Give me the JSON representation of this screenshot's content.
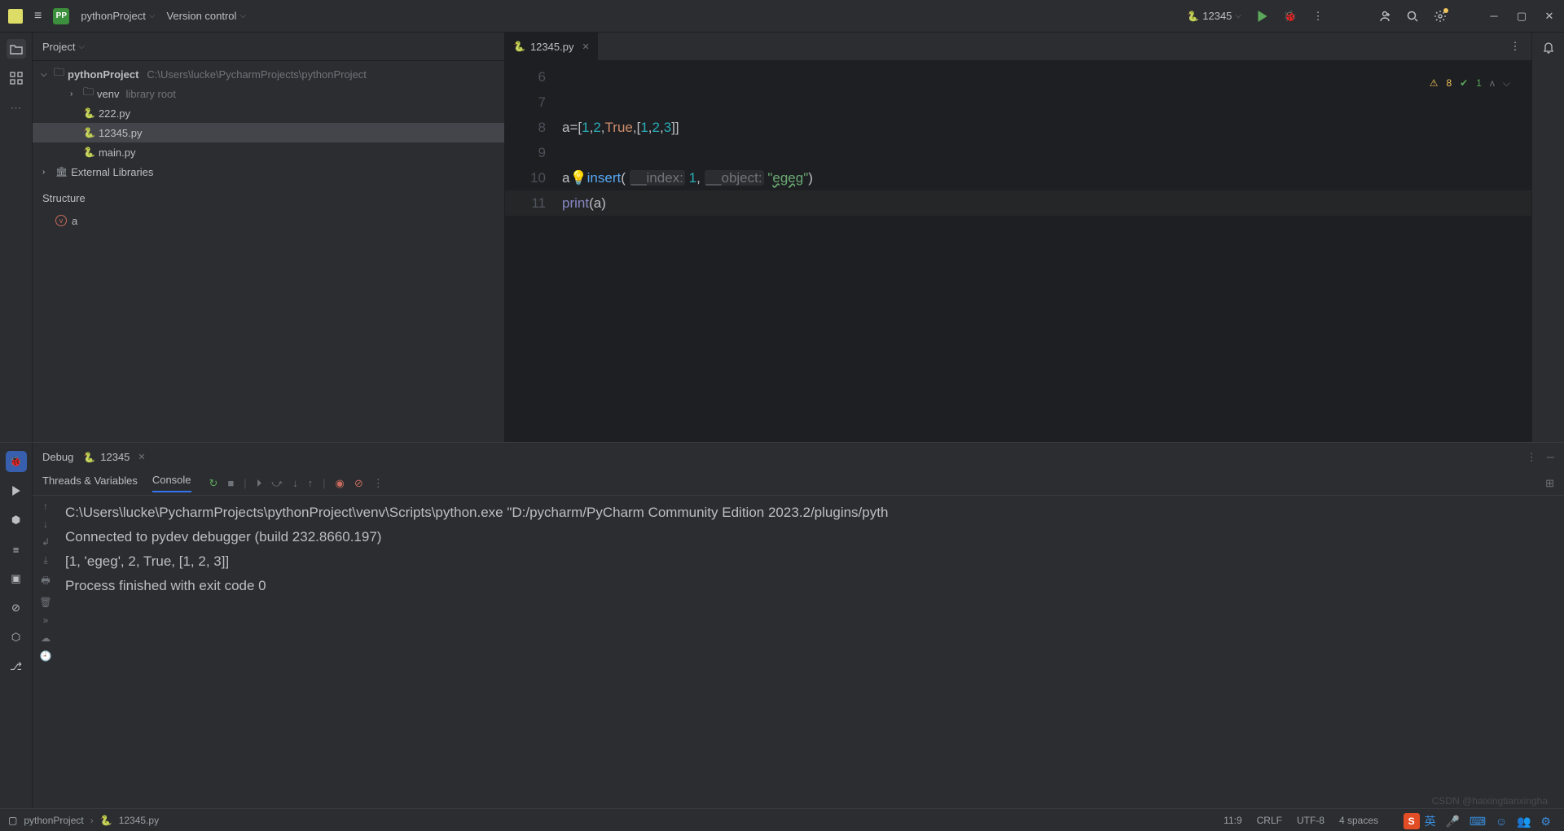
{
  "titlebar": {
    "project_label": "pythonProject",
    "version_control": "Version control",
    "run_config": "12345"
  },
  "project_panel": {
    "title": "Project",
    "root_name": "pythonProject",
    "root_path": "C:\\Users\\lucke\\PycharmProjects\\pythonProject",
    "venv": "venv",
    "venv_note": "library root",
    "files": [
      "222.py",
      "12345.py",
      "main.py"
    ],
    "ext_lib": "External Libraries"
  },
  "structure": {
    "title": "Structure",
    "item": "a"
  },
  "editor": {
    "tab_name": "12345.py",
    "lines": [
      "6",
      "7",
      "8",
      "9",
      "10",
      "11"
    ],
    "code": {
      "l8": {
        "a": "a",
        "eq": "=[",
        "n1": "1",
        "c1": ",",
        "n2": "2",
        "c2": ",",
        "tr": "True",
        "c3": ",[",
        "n3": "1",
        "c4": ",",
        "n4": "2",
        "c5": ",",
        "n5": "3",
        "end": "]]"
      },
      "l10": {
        "obj": "a",
        "dot": ".",
        "fn": "insert",
        "op": "(",
        "h1": "__index:",
        "sp1": " ",
        "v1": "1",
        "cm": ",",
        "sp2": " ",
        "h2": "__object:",
        "sp3": " ",
        "q": "\"",
        "str": "egeg",
        "q2": "\"",
        "cp": ")"
      },
      "l11": {
        "fn": "print",
        "op": "(",
        "arg": "a",
        "cp": ")"
      }
    },
    "inspections": {
      "warn": "8",
      "ok": "1"
    }
  },
  "debug": {
    "label": "Debug",
    "run_name": "12345",
    "subtabs": {
      "threads": "Threads & Variables",
      "console": "Console"
    },
    "console_lines": [
      "C:\\Users\\lucke\\PycharmProjects\\pythonProject\\venv\\Scripts\\python.exe \"D:/pycharm/PyCharm Community Edition 2023.2/plugins/pyth",
      "Connected to pydev debugger (build 232.8660.197)",
      "[1, 'egeg', 2, True, [1, 2, 3]]",
      "",
      "Process finished with exit code 0"
    ]
  },
  "statusbar": {
    "crumb1": "pythonProject",
    "crumb2": "12345.py",
    "pos": "11:9",
    "eol": "CRLF",
    "encoding": "UTF-8",
    "indent": "4 spaces"
  },
  "watermark": "CSDN @haixingtianxingha"
}
